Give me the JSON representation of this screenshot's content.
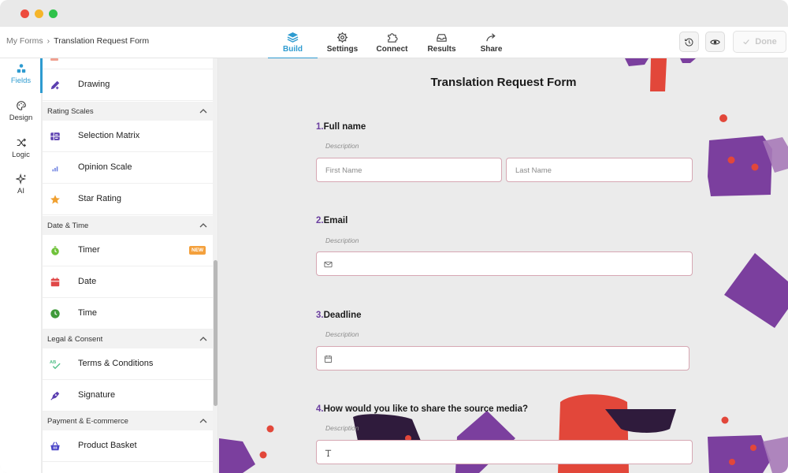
{
  "breadcrumb": {
    "parent": "My Forms",
    "separator": "›",
    "current": "Translation Request Form"
  },
  "nav_tabs": [
    {
      "label": "Build",
      "icon": "layers-icon",
      "active": true
    },
    {
      "label": "Settings",
      "icon": "gear-icon",
      "active": false
    },
    {
      "label": "Connect",
      "icon": "puzzle-icon",
      "active": false
    },
    {
      "label": "Results",
      "icon": "inbox-icon",
      "active": false
    },
    {
      "label": "Share",
      "icon": "share-arrow-icon",
      "active": false
    }
  ],
  "toolbar": {
    "history_icon": "history-icon",
    "preview_icon": "eye-icon",
    "done_label": "Done"
  },
  "left_rail": [
    {
      "label": "Fields",
      "icon": "fields-icon",
      "active": true
    },
    {
      "label": "Design",
      "icon": "palette-icon",
      "active": false
    },
    {
      "label": "Logic",
      "icon": "shuffle-icon",
      "active": false
    },
    {
      "label": "AI",
      "icon": "sparkle-icon",
      "active": false
    }
  ],
  "field_panel": {
    "drawing": "Drawing",
    "rating_scales": {
      "header": "Rating Scales",
      "items": [
        "Selection Matrix",
        "Opinion Scale",
        "Star Rating"
      ]
    },
    "date_time": {
      "header": "Date & Time",
      "items": [
        "Timer",
        "Date",
        "Time"
      ],
      "timer_badge": "NEW"
    },
    "legal": {
      "header": "Legal & Consent",
      "items": [
        "Terms & Conditions",
        "Signature"
      ]
    },
    "payment": {
      "header": "Payment & E-commerce",
      "items": [
        "Product Basket"
      ]
    }
  },
  "form": {
    "title": "Translation Request Form",
    "questions": [
      {
        "number": "1.",
        "label": "Full name",
        "description": "Description",
        "placeholders": [
          "First Name",
          "Last Name"
        ]
      },
      {
        "number": "2.",
        "label": "Email",
        "description": "Description",
        "icon": "mail-icon"
      },
      {
        "number": "3.",
        "label": "Deadline",
        "description": "Description",
        "icon": "calendar-icon"
      },
      {
        "number": "4.",
        "label": "How would you like to share the source media?",
        "description": "Description",
        "icon": "text-t-icon"
      }
    ]
  },
  "colors": {
    "accent": "#2e9bd0",
    "question_number": "#6b3fa0",
    "decor_purple": "#7b3f9e",
    "decor_red": "#e2473a",
    "decor_dark": "#2f1b3c"
  }
}
